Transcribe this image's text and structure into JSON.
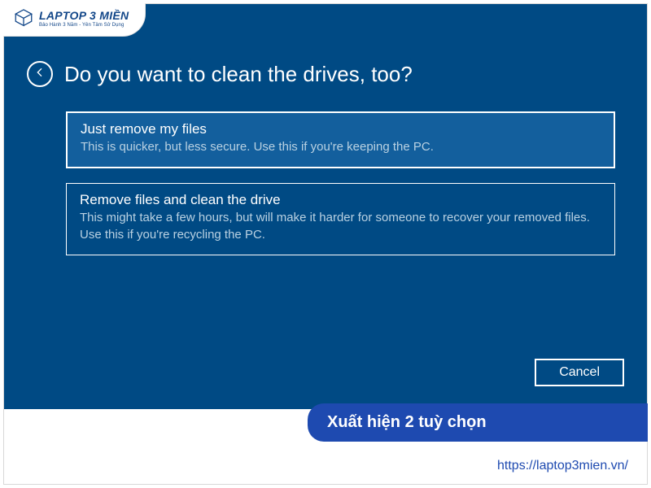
{
  "watermark": {
    "brand": "LAPTOP 3 MIỀN",
    "tagline": "Bảo Hành 3 Năm - Yên Tâm Sử Dụng"
  },
  "screen": {
    "title": "Do you want to clean the drives, too?",
    "options": [
      {
        "title": "Just remove my files",
        "description": "This is quicker, but less secure. Use this if you're keeping the PC."
      },
      {
        "title": "Remove files and clean the drive",
        "description": "This might take a few hours, but will make it harder for someone to recover your removed files. Use this if you're recycling the PC."
      }
    ],
    "cancel_label": "Cancel"
  },
  "caption": "Xuất hiện 2 tuỳ chọn",
  "url": "https://laptop3mien.vn/"
}
